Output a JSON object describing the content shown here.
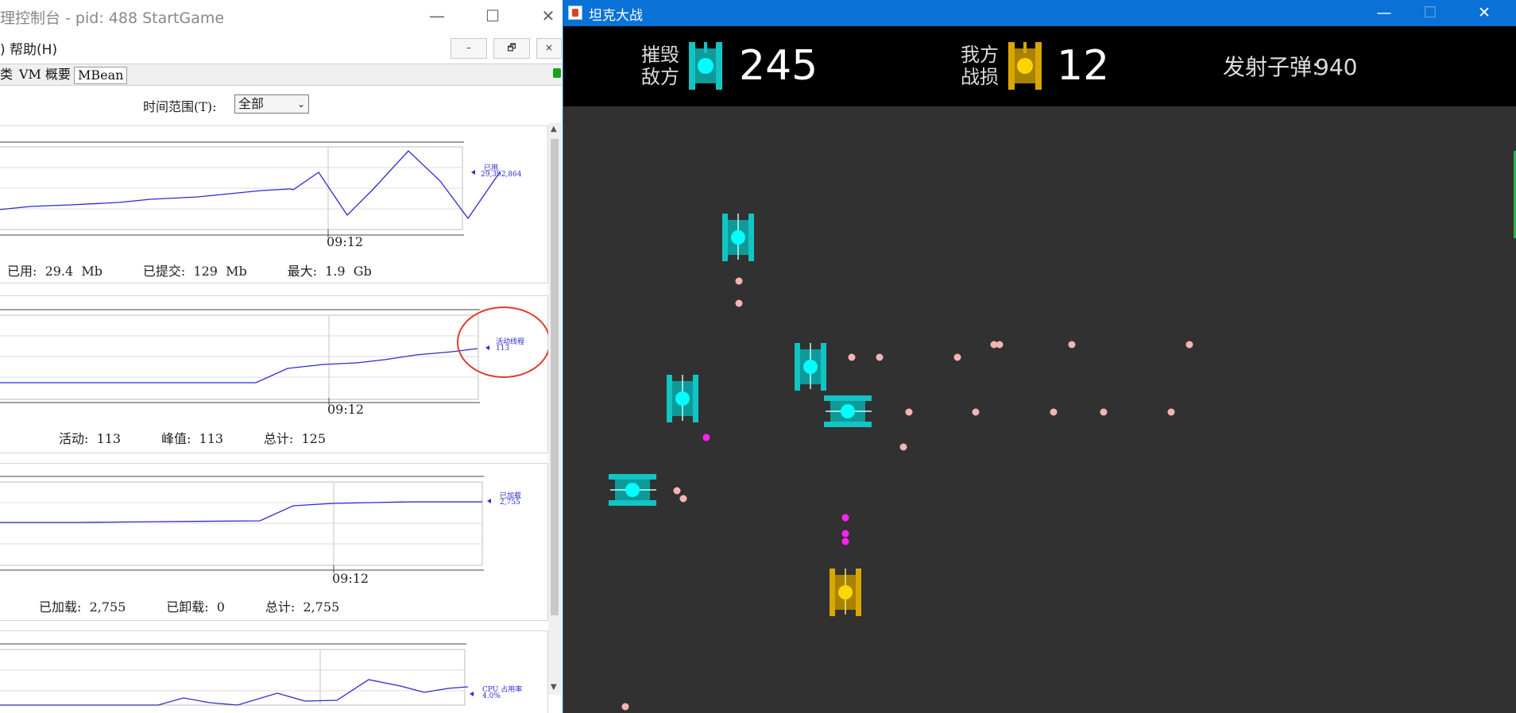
{
  "jconsole": {
    "title": "理控制台 - pid: 488 StartGame",
    "window_buttons": {
      "minimize": "—",
      "maximize": "☐",
      "close": "✕"
    },
    "menu_text": ") 帮助(H)",
    "mdi_buttons": {
      "minimize": "–",
      "restore": "🗗",
      "close": "×"
    },
    "tabs": [
      "类",
      "VM 概要",
      "MBean"
    ],
    "time_range": {
      "label": "时间范围(T):",
      "selected": "全部"
    },
    "panels": [
      {
        "time_label": "09:12",
        "legend_label": "已用",
        "legend_value": "29,392,864",
        "stats": "已用:  29.4  Mb          已提交:  129  Mb          最大:  1.9  Gb"
      },
      {
        "time_label": "09:12",
        "legend_label": "活动线程",
        "legend_value": "113",
        "stats": "活动:  113          峰值:  113          总计:  125"
      },
      {
        "time_label": "09:12",
        "legend_label": "已加载",
        "legend_value": "2,755",
        "stats": "已加载:  2,755          已卸载:  0          总计:  2,755"
      },
      {
        "legend_label": "CPU 占用率",
        "legend_value": "4.0%"
      }
    ],
    "colors": {
      "series": "#2b2bd0",
      "annotation": "#e23b2b"
    }
  },
  "game": {
    "title": "坦克大战",
    "window_buttons": {
      "minimize": "—",
      "maximize": "☐",
      "close": "✕"
    },
    "hud": {
      "destroyed_label_1": "摧毁",
      "destroyed_label_2": "敌方",
      "destroyed_value": "245",
      "losses_label_1": "我方",
      "losses_label_2": "战损",
      "losses_value": "12",
      "bullets_label": "发射子弹:",
      "bullets_value": "940"
    },
    "colors": {
      "background": "#313131",
      "enemy_tank": "#12c4c4",
      "player_tank": "#d9a800",
      "enemy_bullet": "#f5b4b4",
      "player_bullet": "#ff22ff"
    }
  }
}
